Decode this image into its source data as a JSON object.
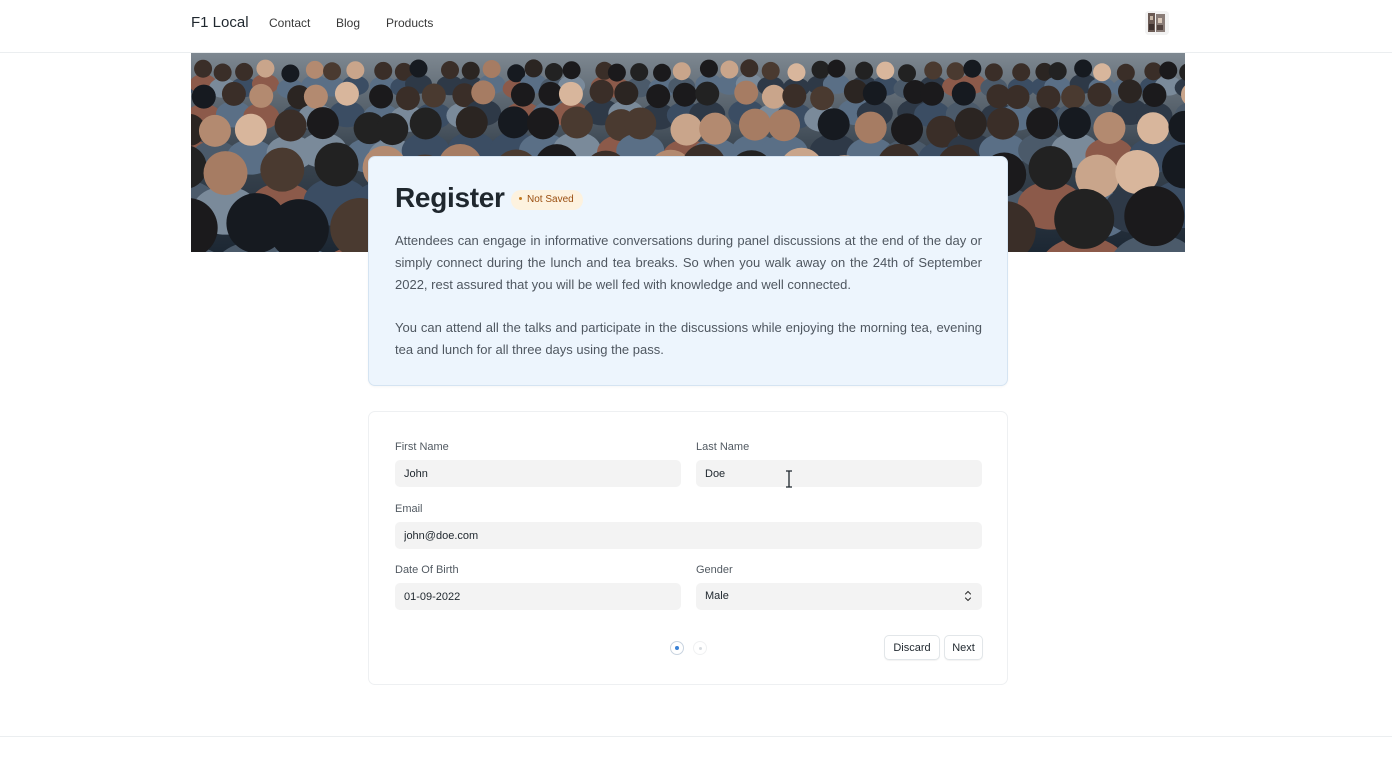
{
  "navbar": {
    "brand": "F1 Local",
    "links": [
      "Contact",
      "Blog",
      "Products"
    ]
  },
  "header": {
    "title": "Register",
    "status": "Not Saved",
    "paragraphs": [
      "Attendees can engage in informative conversations during panel discussions at the end of the day or simply connect during the lunch and tea breaks. So when you walk away on the 24th of September 2022, rest assured that you will be well fed with knowledge and well connected.",
      "You can attend all the talks and participate in the discussions while enjoying the morning tea, evening tea and lunch for all three days using the pass."
    ]
  },
  "form": {
    "first_name": {
      "label": "First Name",
      "value": "John"
    },
    "last_name": {
      "label": "Last Name",
      "value": "Doe"
    },
    "email": {
      "label": "Email",
      "value": "john@doe.com"
    },
    "dob": {
      "label": "Date Of Birth",
      "value": "01-09-2022"
    },
    "gender": {
      "label": "Gender",
      "value": "Male"
    },
    "pages": {
      "current": 1,
      "total": 2
    },
    "discard_label": "Discard",
    "next_label": "Next"
  },
  "colors": {
    "accent": "#3b82d6",
    "intro_bg": "#edf5fd",
    "badge_bg": "#fdf2df",
    "badge_text": "#9a4e10"
  }
}
